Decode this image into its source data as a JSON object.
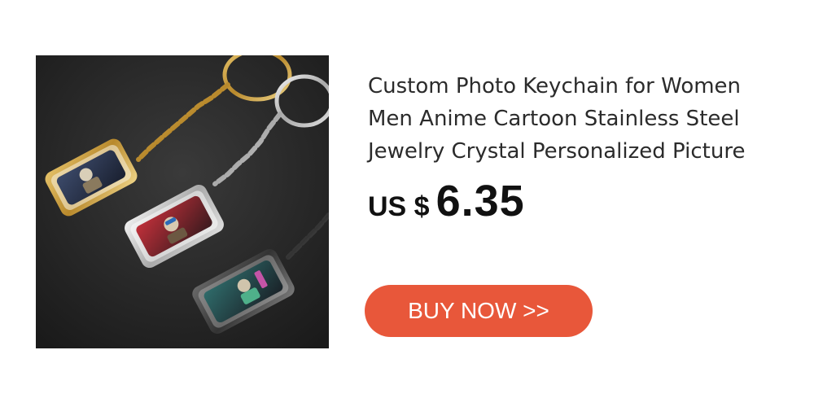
{
  "product": {
    "image_alt": "product-photo",
    "title_lines": [
      "Custom Photo Keychain for Women",
      "Men Anime Cartoon Stainless Steel",
      "Jewelry Crystal Personalized Picture"
    ],
    "price": {
      "currency": "US $",
      "amount": "6.35"
    }
  },
  "cta": {
    "label": "BUY NOW >>",
    "color": "#e8573a"
  }
}
